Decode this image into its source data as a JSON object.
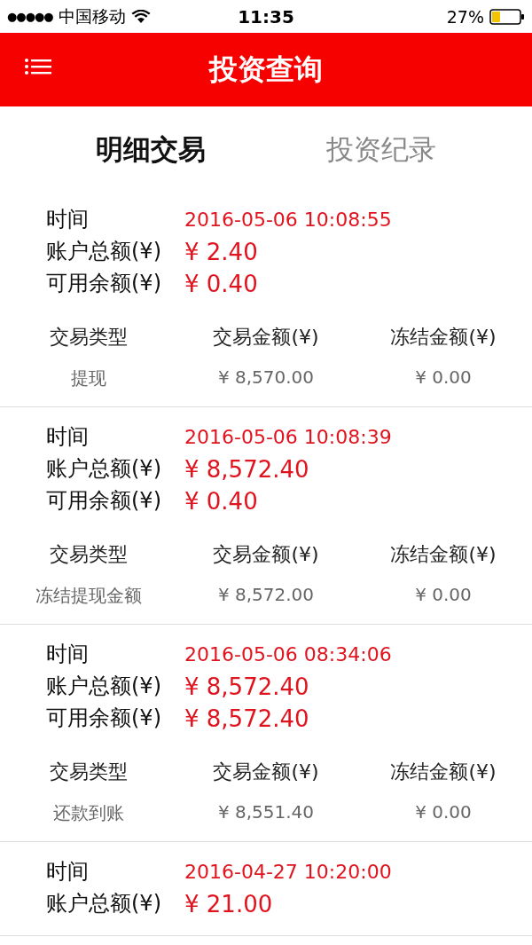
{
  "status_bar": {
    "signal": "●●●●●",
    "carrier": "中国移动",
    "time": "11:35",
    "battery": "27%"
  },
  "header": {
    "title": "投资查询"
  },
  "tabs": [
    {
      "label": "明细交易",
      "selected": true
    },
    {
      "label": "投资纪录",
      "selected": false
    }
  ],
  "records": [
    {
      "time_label": "时间",
      "time": "2016-05-06 10:08:55",
      "total_label": "账户总额(¥)",
      "total": "¥ 2.40",
      "available_label": "可用余额(¥)",
      "available": "¥ 0.40",
      "columns": [
        "交易类型",
        "交易金额(¥)",
        "冻结金额(¥)"
      ],
      "values": [
        "提现",
        "¥ 8,570.00",
        "¥ 0.00"
      ]
    },
    {
      "time_label": "时间",
      "time": "2016-05-06 10:08:39",
      "total_label": "账户总额(¥)",
      "total": "¥ 8,572.40",
      "available_label": "可用余额(¥)",
      "available": "¥ 0.40",
      "columns": [
        "交易类型",
        "交易金额(¥)",
        "冻结金额(¥)"
      ],
      "values": [
        "冻结提现金额",
        "¥ 8,572.00",
        "¥ 0.00"
      ]
    },
    {
      "time_label": "时间",
      "time": "2016-05-06 08:34:06",
      "total_label": "账户总额(¥)",
      "total": "¥ 8,572.40",
      "available_label": "可用余额(¥)",
      "available": "¥ 8,572.40",
      "columns": [
        "交易类型",
        "交易金额(¥)",
        "冻结金额(¥)"
      ],
      "values": [
        "还款到账",
        "¥ 8,551.40",
        "¥ 0.00"
      ]
    },
    {
      "time_label": "时间",
      "time": "2016-04-27 10:20:00",
      "total_label": "账户总额(¥)",
      "total": "¥ 21.00"
    }
  ]
}
